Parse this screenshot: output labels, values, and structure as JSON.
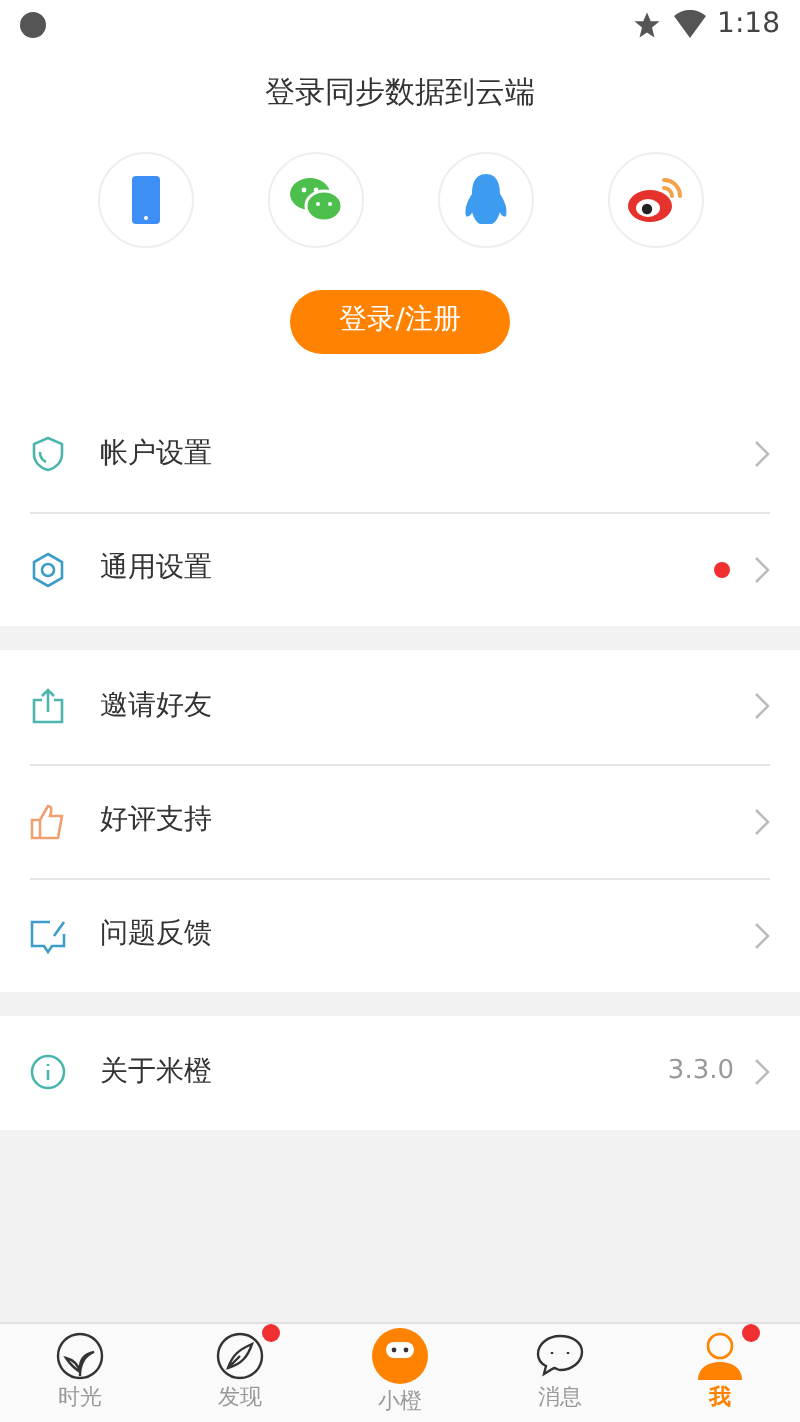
{
  "status_bar": {
    "time": "1:18"
  },
  "login": {
    "title": "登录同步数据到云端",
    "methods": [
      {
        "kind": "phone"
      },
      {
        "kind": "wechat"
      },
      {
        "kind": "qq"
      },
      {
        "kind": "weibo"
      }
    ],
    "button": "登录/注册"
  },
  "groups": [
    {
      "items": [
        {
          "kind": "shield",
          "label": "帐户设置",
          "dot": false
        },
        {
          "kind": "hexagon",
          "label": "通用设置",
          "dot": true
        }
      ]
    },
    {
      "items": [
        {
          "kind": "share",
          "label": "邀请好友",
          "dot": false
        },
        {
          "kind": "thumb",
          "label": "好评支持",
          "dot": false
        },
        {
          "kind": "feedback",
          "label": "问题反馈",
          "dot": false
        }
      ]
    },
    {
      "items": [
        {
          "kind": "info",
          "label": "关于米橙",
          "dot": false,
          "value": "3.3.0"
        }
      ]
    }
  ],
  "tabs": [
    {
      "kind": "leaf",
      "label": "时光",
      "selected": false,
      "badge": false
    },
    {
      "kind": "compass",
      "label": "发现",
      "selected": false,
      "badge": true
    },
    {
      "kind": "mascot",
      "label": "小橙",
      "selected": false,
      "badge": false
    },
    {
      "kind": "chat",
      "label": "消息",
      "selected": false,
      "badge": false
    },
    {
      "kind": "person",
      "label": "我",
      "selected": true,
      "badge": true
    }
  ]
}
